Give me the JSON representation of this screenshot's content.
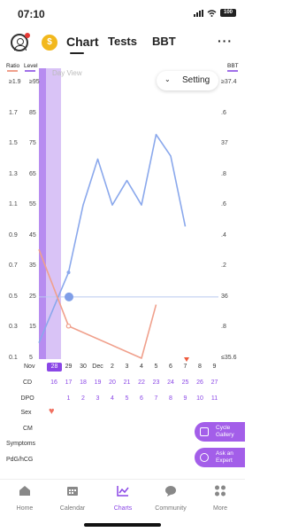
{
  "status": {
    "time": "07:10",
    "battery": "100"
  },
  "header": {
    "coin_icon": "dollar-coin-icon",
    "tabs": [
      {
        "label": "Chart",
        "active": true
      },
      {
        "label": "Tests",
        "active": false
      },
      {
        "label": "BBT",
        "active": false
      }
    ],
    "more_icon": "ellipsis-icon",
    "more_label": "···"
  },
  "chart": {
    "ratio_label": "Ratio",
    "level_label": "Level",
    "bbt_label": "BBT",
    "day_view_label": "Day View",
    "setting_label": "Setting",
    "chevron": "⌄",
    "ratio_ticks": [
      "≥1.9",
      "1.7",
      "1.5",
      "1.3",
      "1.1",
      "0.9",
      "0.7",
      "0.5",
      "0.3",
      "0.1"
    ],
    "level_ticks": [
      "≥95",
      "85",
      "75",
      "65",
      "55",
      "45",
      "35",
      "25",
      "15",
      "5"
    ],
    "bbt_ticks": [
      "≥37.4",
      ".6",
      "37",
      ".8",
      ".6",
      ".4",
      ".2",
      "36",
      ".8",
      "≤35.6"
    ],
    "month_label": "Nov",
    "dec_label": "Dec",
    "dates": [
      "28",
      "29",
      "30",
      "Dec",
      "2",
      "3",
      "4",
      "5",
      "6",
      "7",
      "8",
      "9"
    ],
    "selected_date": "28"
  },
  "chart_data": {
    "type": "line",
    "x": [
      "Nov 28",
      "Nov 29",
      "Nov 30",
      "Dec 1",
      "Dec 2",
      "Dec 3",
      "Dec 4",
      "Dec 5",
      "Dec 6",
      "Dec 7",
      "Dec 8",
      "Dec 9"
    ],
    "series": [
      {
        "color": "#8aa8ec",
        "axis": "level",
        "values": [
          10,
          33,
          55,
          70,
          55,
          63,
          55,
          78,
          71,
          48,
          null,
          null
        ]
      },
      {
        "color": "#f0a08c",
        "axis": "ratio",
        "values": [
          0.81,
          0.31,
          null,
          null,
          null,
          null,
          0.1,
          0.45,
          null,
          null,
          null,
          null
        ]
      }
    ],
    "reference_line": {
      "axis": "level",
      "value": 25
    },
    "ratio_range": [
      0.1,
      1.9
    ],
    "level_range": [
      5,
      95
    ],
    "grid": false
  },
  "records": {
    "rows": [
      {
        "label": "CD",
        "values": [
          "16",
          "17",
          "18",
          "19",
          "20",
          "21",
          "22",
          "23",
          "24",
          "25",
          "26",
          "27"
        ]
      },
      {
        "label": "DPO",
        "values": [
          "",
          "1",
          "2",
          "3",
          "4",
          "5",
          "6",
          "7",
          "8",
          "9",
          "10",
          "11"
        ]
      },
      {
        "label": "Sex",
        "values": []
      },
      {
        "label": "CM",
        "values": []
      },
      {
        "label": "Symptoms",
        "values": []
      },
      {
        "label": "PdG/hCG",
        "values": []
      }
    ],
    "heart_icon": "heart-icon"
  },
  "fabs": [
    {
      "label": "Cycle Gallery",
      "icon": "gallery-icon"
    },
    {
      "label": "Ask an Expert",
      "icon": "chat-expert-icon"
    }
  ],
  "nav": [
    {
      "label": "Home",
      "icon": "home-icon",
      "active": false
    },
    {
      "label": "Calendar",
      "icon": "calendar-icon",
      "active": false
    },
    {
      "label": "Charts",
      "icon": "chart-icon",
      "active": true
    },
    {
      "label": "Community",
      "icon": "community-icon",
      "active": false
    },
    {
      "label": "More",
      "icon": "grid-icon",
      "active": false
    }
  ],
  "colors": {
    "accent": "#8a46e6",
    "highlight_band": "#d9c3f6",
    "level_line": "#8aa8ec",
    "ratio_line": "#f0a08c"
  }
}
